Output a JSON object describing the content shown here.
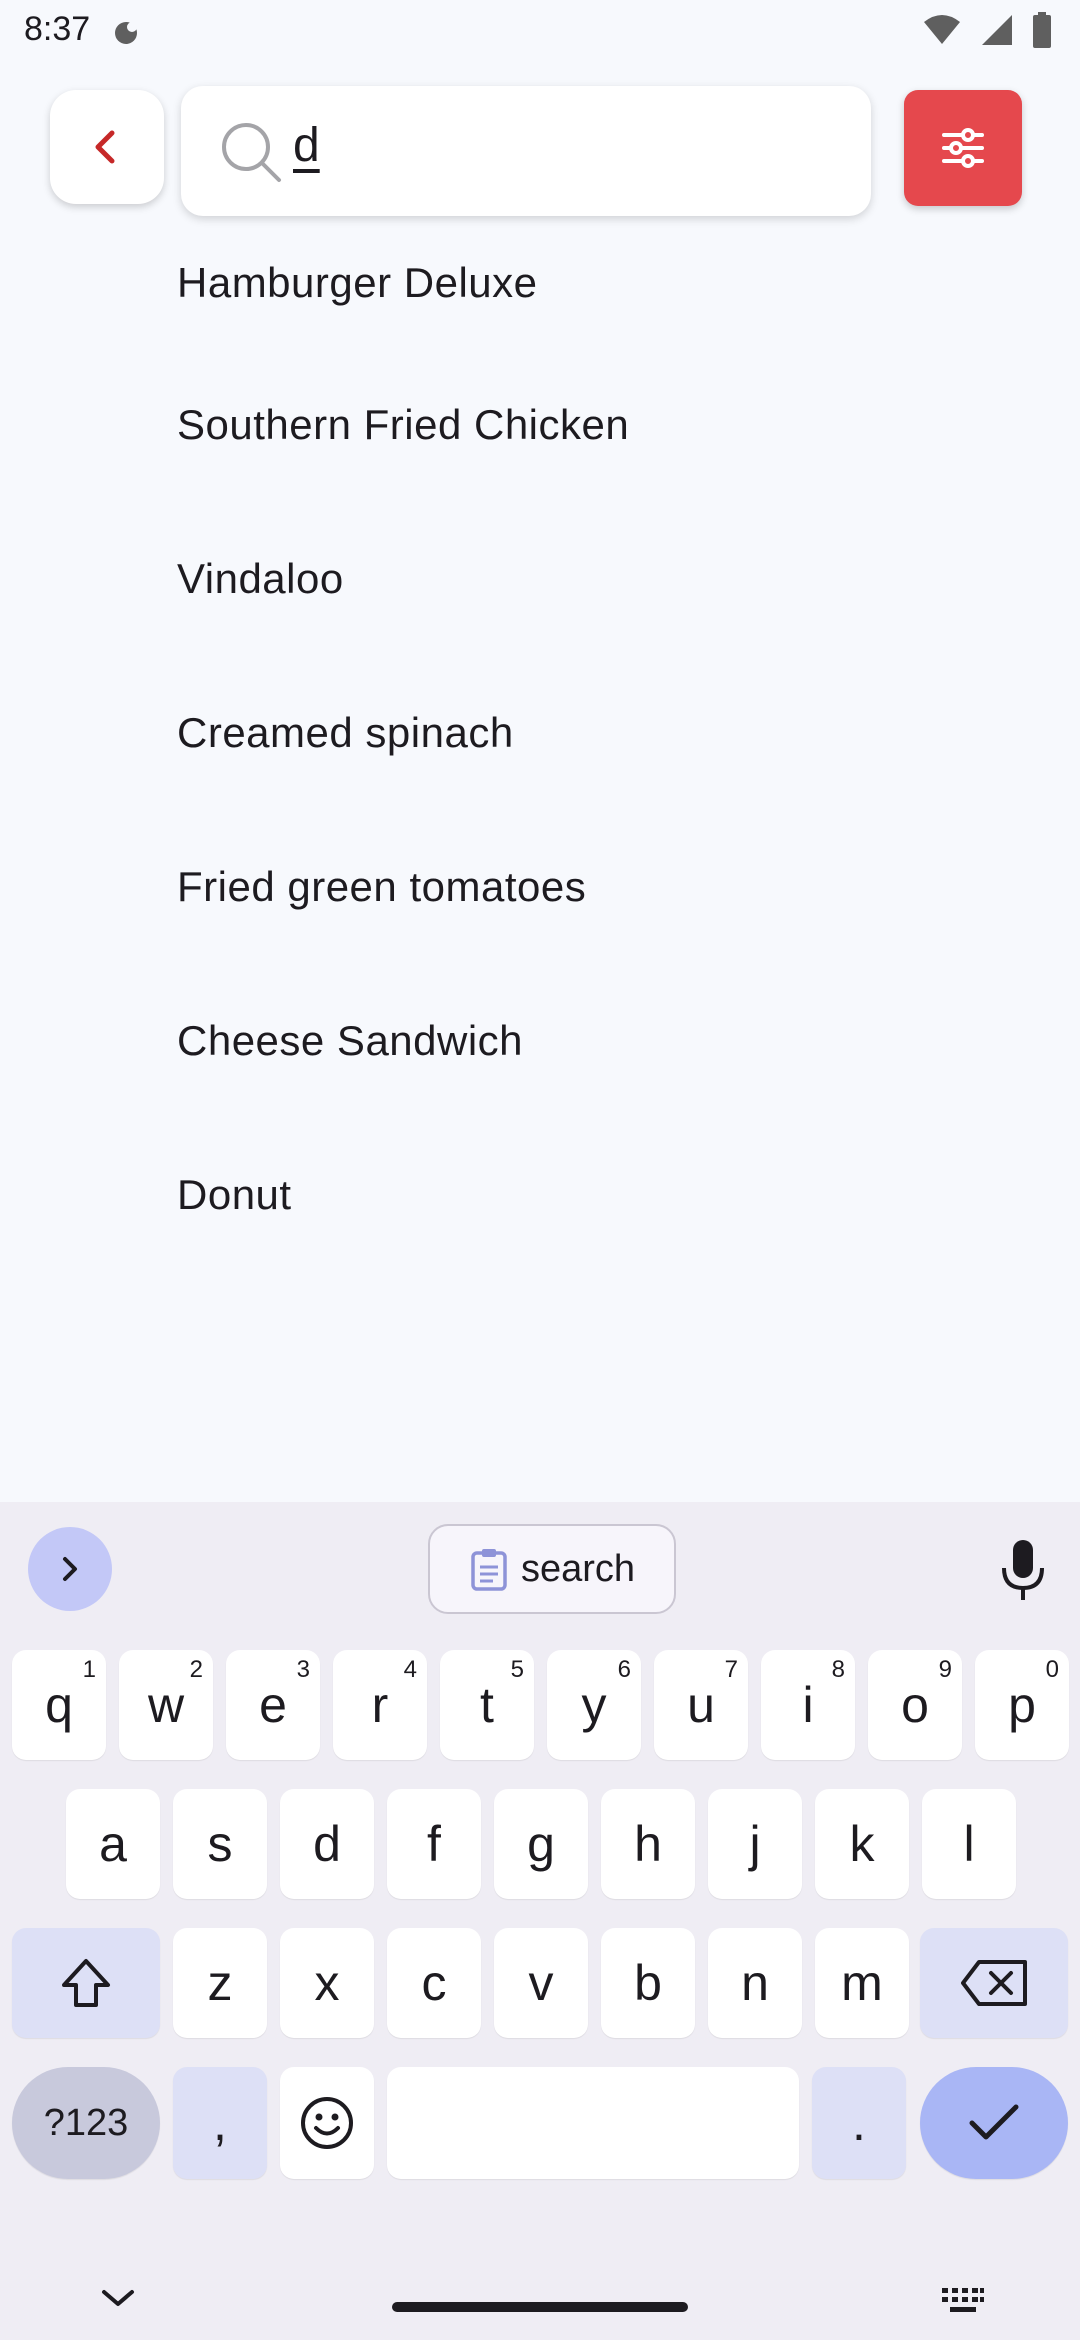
{
  "status_bar": {
    "time": "8:37"
  },
  "search": {
    "value": "d"
  },
  "results": [
    "Hamburger Deluxe",
    "Southern Fried Chicken",
    "Vindaloo",
    "Creamed spinach",
    "Fried green tomatoes",
    "Cheese Sandwich",
    "Donut"
  ],
  "keyboard": {
    "suggestion": "search",
    "row1": [
      {
        "k": "q",
        "h": "1"
      },
      {
        "k": "w",
        "h": "2"
      },
      {
        "k": "e",
        "h": "3"
      },
      {
        "k": "r",
        "h": "4"
      },
      {
        "k": "t",
        "h": "5"
      },
      {
        "k": "y",
        "h": "6"
      },
      {
        "k": "u",
        "h": "7"
      },
      {
        "k": "i",
        "h": "8"
      },
      {
        "k": "o",
        "h": "9"
      },
      {
        "k": "p",
        "h": "0"
      }
    ],
    "row2": [
      "a",
      "s",
      "d",
      "f",
      "g",
      "h",
      "j",
      "k",
      "l"
    ],
    "row3": [
      "z",
      "x",
      "c",
      "v",
      "b",
      "n",
      "m"
    ],
    "symbols_label": "?123",
    "comma": ",",
    "period": "."
  },
  "colors": {
    "accent": "#e5484d",
    "back_icon": "#c62828",
    "keyboard_accent": "#a9b6f5"
  }
}
